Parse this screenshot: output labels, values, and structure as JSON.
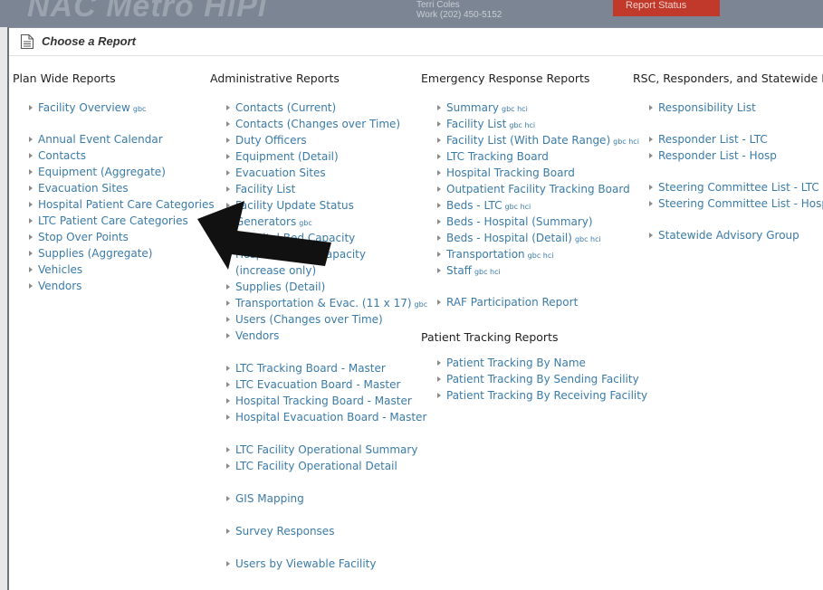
{
  "background": {
    "logo_text": "NAC Metro HiPi",
    "contact_line1": "Terri Coles",
    "contact_line2": "Work (202) 450-5152",
    "badge_label": "Report Status"
  },
  "modal": {
    "title": "Choose a Report",
    "icon": "document-icon"
  },
  "columns": [
    {
      "heading": "Plan Wide Reports",
      "items": [
        {
          "label": "Facility Overview",
          "suffix": "gbc"
        },
        {
          "label": "Annual Event Calendar"
        },
        {
          "label": "Contacts"
        },
        {
          "label": "Equipment (Aggregate)"
        },
        {
          "label": "Evacuation Sites"
        },
        {
          "label": "Hospital Patient Care Categories"
        },
        {
          "label": "LTC Patient Care Categories"
        },
        {
          "label": "Stop Over Points"
        },
        {
          "label": "Supplies (Aggregate)"
        },
        {
          "label": "Vehicles"
        },
        {
          "label": "Vendors"
        }
      ]
    },
    {
      "heading": "Administrative Reports",
      "items": [
        {
          "label": "Contacts (Current)"
        },
        {
          "label": "Contacts (Changes over Time)"
        },
        {
          "label": "Duty Officers"
        },
        {
          "label": "Equipment (Detail)"
        },
        {
          "label": "Evacuation Sites"
        },
        {
          "label": "Facility List"
        },
        {
          "label": "Facility Update Status"
        },
        {
          "label": "Generators",
          "suffix": "gbc"
        },
        {
          "label": "Hospital Bed Capacity"
        },
        {
          "label": "Hospital Surge Capacity"
        },
        {
          "label": "(increase only)"
        },
        {
          "label": "Supplies (Detail)"
        },
        {
          "label": "Transportation & Evac. (11 x 17)",
          "suffix": "gbc"
        },
        {
          "label": "Users (Changes over Time)"
        },
        {
          "label": "Vendors"
        },
        {
          "label": "LTC Tracking Board - Master"
        },
        {
          "label": "LTC Evacuation Board - Master"
        },
        {
          "label": "Hospital Tracking Board - Master"
        },
        {
          "label": "Hospital Evacuation Board - Master"
        },
        {
          "label": "LTC Facility Operational Summary"
        },
        {
          "label": "LTC Facility Operational Detail"
        },
        {
          "label": "GIS Mapping"
        },
        {
          "label": "Survey Responses"
        },
        {
          "label": "Users by Viewable Facility"
        }
      ]
    },
    {
      "heading": "Emergency Response Reports",
      "items": [
        {
          "label": "Summary",
          "suffix": "gbc hci"
        },
        {
          "label": "Facility List",
          "suffix": "gbc hci"
        },
        {
          "label": "Facility List (With Date Range)",
          "suffix": "gbc hci"
        },
        {
          "label": "LTC Tracking Board"
        },
        {
          "label": "Hospital Tracking Board"
        },
        {
          "label": "Outpatient Facility Tracking Board"
        },
        {
          "label": "Beds - LTC",
          "suffix": "gbc hci"
        },
        {
          "label": "Beds - Hospital (Summary)"
        },
        {
          "label": "Beds - Hospital (Detail)",
          "suffix": "gbc hci"
        },
        {
          "label": "Transportation",
          "suffix": "gbc hci"
        },
        {
          "label": "Staff",
          "suffix": "gbc hci"
        },
        {
          "label": "RAF Participation Report"
        }
      ],
      "subheading": "Patient Tracking Reports",
      "sub_items": [
        {
          "label": "Patient Tracking By Name"
        },
        {
          "label": "Patient Tracking By Sending Facility"
        },
        {
          "label": "Patient Tracking By Receiving Facility"
        }
      ]
    },
    {
      "heading": "RSC, Responders, and Statewide List",
      "items": [
        {
          "label": "Responsibility List"
        },
        {
          "label": "Responder List - LTC"
        },
        {
          "label": "Responder List - Hosp"
        },
        {
          "label": "Steering Committee List - LTC"
        },
        {
          "label": "Steering Committee List - Hosp"
        },
        {
          "label": "Statewide Advisory Group"
        }
      ]
    }
  ],
  "colors": {
    "link": "#3a7ba8",
    "heading": "#222222",
    "arrow": "#111111"
  }
}
